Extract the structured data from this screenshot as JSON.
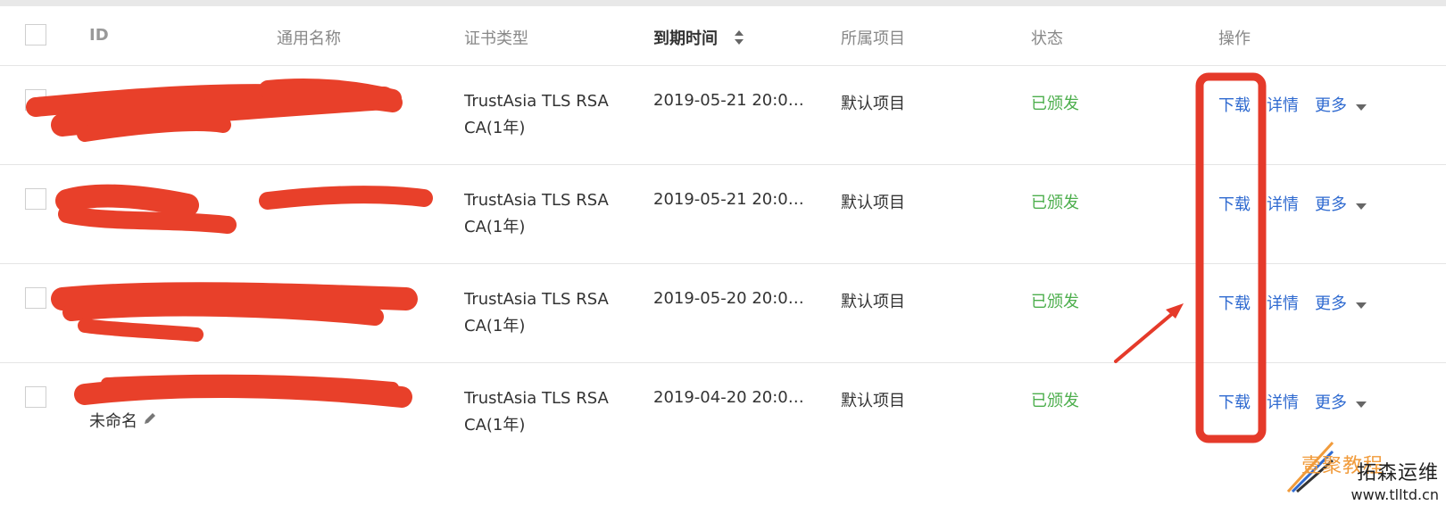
{
  "header": {
    "id": "ID",
    "common_name": "通用名称",
    "cert_type": "证书类型",
    "expire": "到期时间",
    "project": "所属项目",
    "status": "状态",
    "actions": "操作"
  },
  "rows": [
    {
      "cert_type_1": "TrustAsia TLS RSA",
      "cert_type_2": "CA(1年)",
      "expire": "2019-05-21 20:0…",
      "project": "默认项目",
      "status": "已颁发",
      "download": "下载",
      "detail": "详情",
      "more": "更多"
    },
    {
      "cert_type_1": "TrustAsia TLS RSA",
      "cert_type_2": "CA(1年)",
      "expire": "2019-05-21 20:0…",
      "project": "默认项目",
      "status": "已颁发",
      "download": "下载",
      "detail": "详情",
      "more": "更多"
    },
    {
      "cert_type_1": "TrustAsia TLS RSA",
      "cert_type_2": "CA(1年)",
      "expire": "2019-05-20 20:0…",
      "project": "默认项目",
      "status": "已颁发",
      "download": "下载",
      "detail": "详情",
      "more": "更多"
    },
    {
      "cert_type_1": "TrustAsia TLS RSA",
      "cert_type_2": "CA(1年)",
      "expire": "2019-04-20 20:0…",
      "project": "默认项目",
      "status": "已颁发",
      "download": "下载",
      "detail": "详情",
      "more": "更多",
      "id_remark": "未命名"
    }
  ],
  "watermark": {
    "line1": "壹聚教程",
    "line2": "拓森运维",
    "line3": "www.tlltd.cn"
  },
  "colors": {
    "link": "#2f6ad0",
    "status_ok": "#4cae4c",
    "highlight_box": "#e53a2a",
    "redaction": "#e8402a"
  },
  "icons": {
    "sort": "sort-icon",
    "edit": "pencil-icon",
    "dropdown": "caret-down-icon",
    "arrow": "annotation-arrow-icon"
  }
}
